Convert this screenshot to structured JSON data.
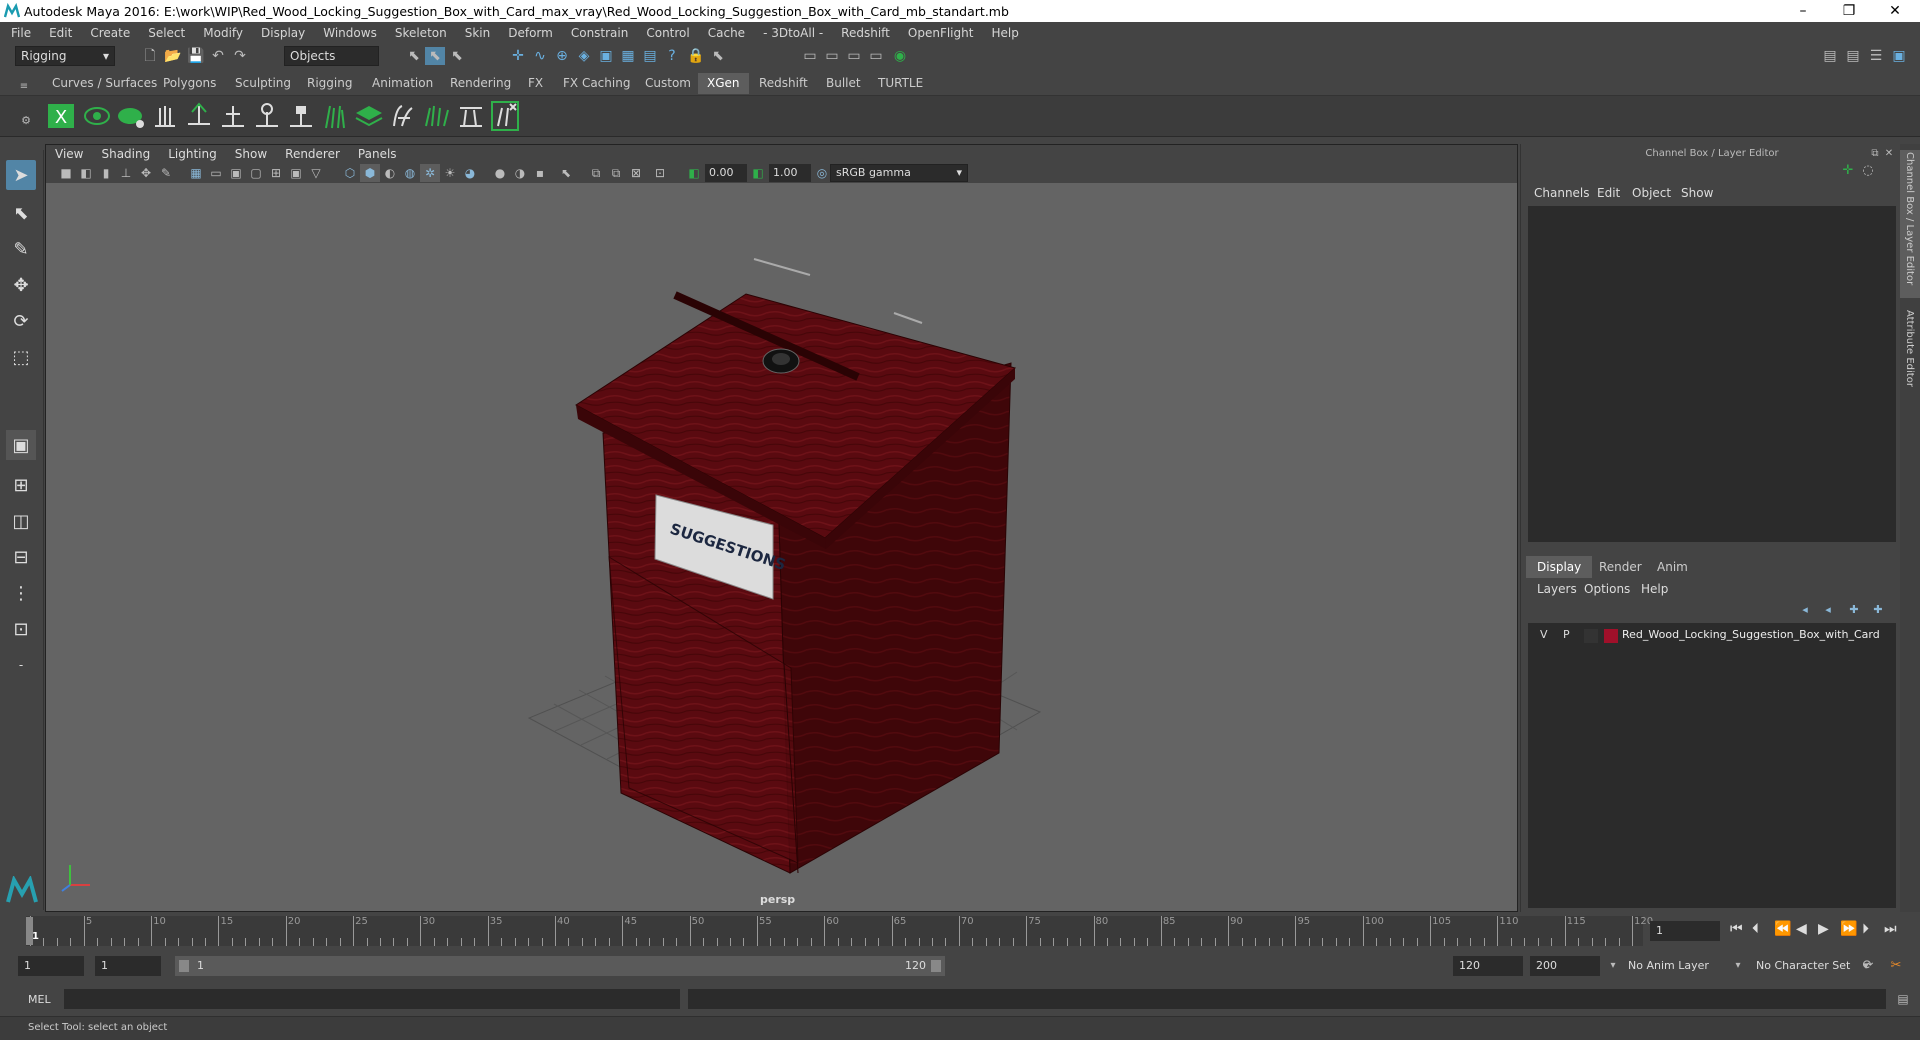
{
  "window": {
    "title": "Autodesk Maya 2016: E:\\work\\WIP\\Red_Wood_Locking_Suggestion_Box_with_Card_max_vray\\Red_Wood_Locking_Suggestion_Box_with_Card_mb_standart.mb",
    "minimize": "–",
    "maximize": "❐",
    "close": "✕"
  },
  "menubar": [
    "File",
    "Edit",
    "Create",
    "Select",
    "Modify",
    "Display",
    "Windows",
    "Skeleton",
    "Skin",
    "Deform",
    "Constrain",
    "Control",
    "Cache",
    "- 3DtoAll -",
    "Redshift",
    "OpenFlight",
    "Help"
  ],
  "toolbar": {
    "menuset": "Rigging",
    "selection_mode": "Objects"
  },
  "shelf_tabs": [
    "Curves / Surfaces",
    "Polygons",
    "Sculpting",
    "Rigging",
    "Animation",
    "Rendering",
    "FX",
    "FX Caching",
    "Custom",
    "XGen",
    "Redshift",
    "Bullet",
    "TURTLE"
  ],
  "active_shelf_tab": "XGen",
  "viewport": {
    "menu": [
      "View",
      "Shading",
      "Lighting",
      "Show",
      "Renderer",
      "Panels"
    ],
    "near_value": "0.00",
    "far_value": "1.00",
    "color_space": "sRGB gamma",
    "camera_label": "persp",
    "sign_text": "SUGGESTIONS"
  },
  "right_panel": {
    "title": "Channel Box / Layer Editor",
    "channel_menu": [
      "Channels",
      "Edit",
      "Object",
      "Show"
    ],
    "layer_tabs": [
      "Display",
      "Render",
      "Anim"
    ],
    "active_layer_tab": "Display",
    "layer_menu": [
      "Layers",
      "Options",
      "Help"
    ],
    "layer": {
      "visible": "V",
      "playback": "P",
      "name": "Red_Wood_Locking_Suggestion_Box_with_Card",
      "color": "#a0102a"
    },
    "side_tabs": [
      "Channel Box / Layer Editor",
      "Attribute Editor"
    ]
  },
  "timeline": {
    "labels": [
      "1",
      "5",
      "10",
      "15",
      "20",
      "25",
      "30",
      "35",
      "40",
      "45",
      "50",
      "55",
      "60",
      "65",
      "70",
      "75",
      "80",
      "85",
      "90",
      "95",
      "100",
      "105",
      "110",
      "115",
      "120"
    ],
    "current_frame": "1"
  },
  "range": {
    "start": "1",
    "playback_start": "1",
    "slider_start": "1",
    "slider_end": "120",
    "playback_end": "120",
    "end": "200",
    "anim_layer": "No Anim Layer",
    "character_set": "No Character Set"
  },
  "command": {
    "label": "MEL"
  },
  "status": {
    "text": "Select Tool: select an object"
  },
  "colors": {
    "accent": "#5285a6",
    "box_wood": "#5a0a10",
    "xgen_green": "#2fb04a"
  }
}
